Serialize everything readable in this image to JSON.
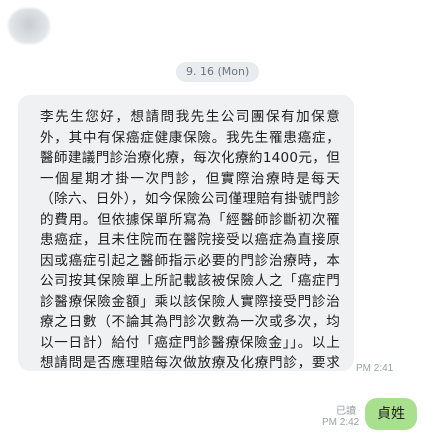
{
  "chat": {
    "date_separator": "9. 16 (Mon)",
    "incoming": {
      "text": "李先生您好，想請問我先生公司團保有加保意外，其中有保癌症健康保險。我先生罹患癌症，醫師建議門診治療化療，每次化療約1400元，但一個星期才掛一次門診，但實際治療時是每天（除六、日外），如今保險公司僅理賠有掛號門診的費用。但依據保單所寫為「經醫師診斷初次罹患癌症，且未住院而在醫院接受以癌症為直接原因或癌症引起之醫師指示必要的門診治療時，本公司按其保險單上所記載該被保險人之「癌症門診醫療保險金額」乘以該保險人實際接受門診治療之日數（不論其為門診次數為一次或多次，均以一日計）給付「癌症門診醫療保險金」」。以上想請問是否應理賠每次做放療及化療門診，要求保險公司給付呢？",
      "time": "PM 2:41"
    },
    "outgoing": {
      "text": "貞姓",
      "read_status": "已讀",
      "time": "PM 2:42"
    }
  },
  "colors": {
    "incoming_bubble": "#f0f1f3",
    "outgoing_bubble": "#a8e08f",
    "date_pill": "#e9ecef",
    "meta_text": "#9aa1a8"
  }
}
